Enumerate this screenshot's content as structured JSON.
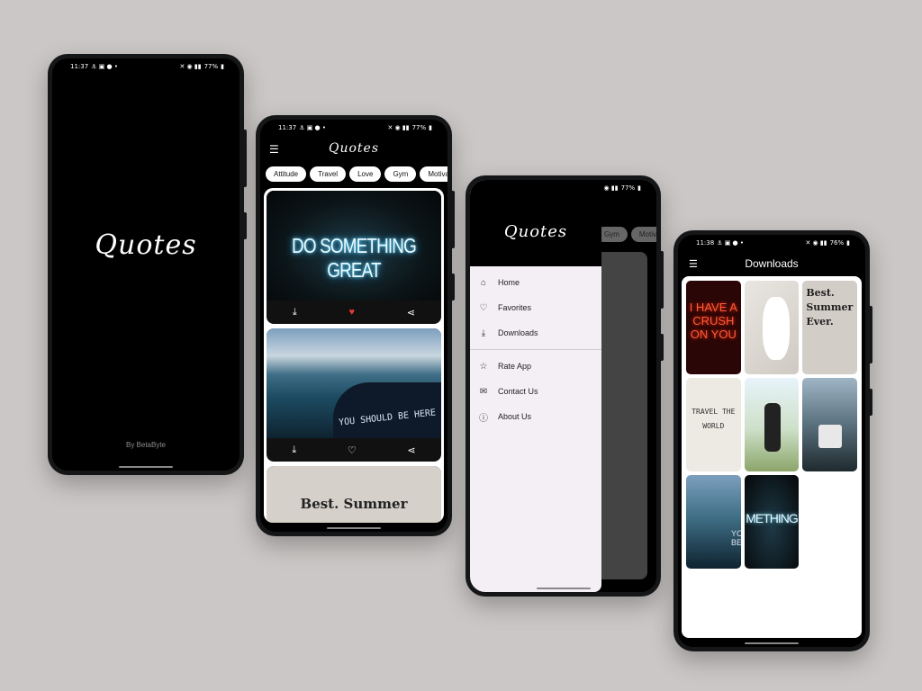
{
  "status_bar": {
    "time1": "11:37",
    "time4": "11:38",
    "battery1": "77%",
    "battery4": "76%"
  },
  "splash": {
    "logo": "Quotes",
    "byline": "By BetaByte"
  },
  "home": {
    "logo": "Quotes",
    "categories": [
      "Attitude",
      "Travel",
      "Love",
      "Gym",
      "Motivati"
    ],
    "cards": [
      {
        "image_text": "DO SOMETHING GREAT",
        "liked": true
      },
      {
        "image_text": "YOU SHOULD BE HERE",
        "liked": false
      },
      {
        "image_text": "Best. Summer",
        "liked": false
      }
    ]
  },
  "drawer": {
    "logo": "Quotes",
    "behind_chips": [
      "Gym",
      "Motivati"
    ],
    "items_main": [
      {
        "label": "Home",
        "icon": "home-icon"
      },
      {
        "label": "Favorites",
        "icon": "heart-icon"
      },
      {
        "label": "Downloads",
        "icon": "download-icon"
      }
    ],
    "items_secondary": [
      {
        "label": "Rate App",
        "icon": "star-icon"
      },
      {
        "label": "Contact Us",
        "icon": "mail-icon"
      },
      {
        "label": "About Us",
        "icon": "info-icon"
      }
    ]
  },
  "downloads": {
    "title": "Downloads",
    "tiles": [
      {
        "text": "I HAVE A CRUSH ON YOU"
      },
      {
        "text": ""
      },
      {
        "text": "Best. Summer Ever."
      },
      {
        "text": "TRAVEL THE WORLD"
      },
      {
        "text": ""
      },
      {
        "text": ""
      },
      {
        "text": "YOU BE"
      },
      {
        "text": "METHING"
      }
    ]
  },
  "colors": {
    "background": "#cbc7c6",
    "phone_body": "#141618",
    "screen_black": "#000000",
    "like_red": "#e53935",
    "drawer_bg": "#f3eff5"
  }
}
